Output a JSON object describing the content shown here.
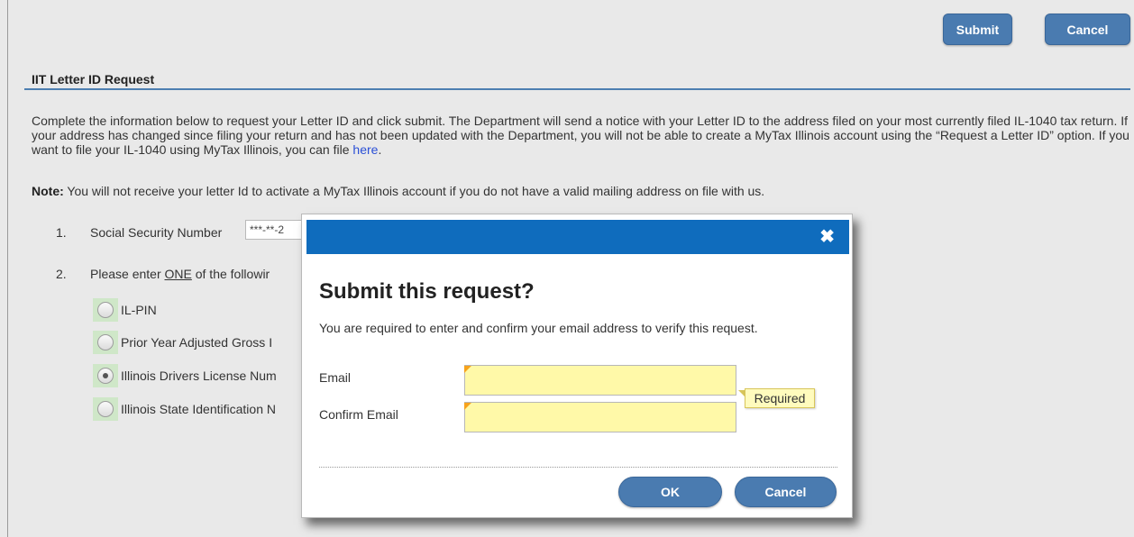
{
  "toolbar": {
    "submit_label": "Submit",
    "cancel_label": "Cancel"
  },
  "section": {
    "title": "IIT Letter ID Request"
  },
  "intro": {
    "text": "Complete the information below to request your Letter ID and click submit. The Department will send a notice with your Letter ID to the address filed on your most currently filed IL-1040 tax return. If your address has changed since filing your return and has not been updated with the Department, you will not be able to create a MyTax Illinois account using the “Request a Letter ID” option. If you want to file your IL-1040 using MyTax Illinois, you can file ",
    "link": "here",
    "end": "."
  },
  "note": {
    "label": "Note:",
    "text": " You will not receive your letter Id to activate a MyTax Illinois account if you do not have a valid mailing address on file with us."
  },
  "steps": [
    {
      "num": "1.",
      "text": "Social Security Number",
      "value": "***-**-2"
    },
    {
      "num": "2.",
      "text_before": "Please enter ",
      "text_underline": "ONE",
      "text_after": " of the followir"
    }
  ],
  "options": [
    {
      "label": "IL-PIN",
      "selected": false
    },
    {
      "label": "Prior Year Adjusted Gross I",
      "selected": false
    },
    {
      "label": "Illinois Drivers License Num",
      "selected": true
    },
    {
      "label": "Illinois State Identification N",
      "selected": false
    }
  ],
  "modal": {
    "close_glyph": "✖",
    "title": "Submit this request?",
    "description": "You are required to enter and confirm your email address to verify this request.",
    "email_label": "Email",
    "confirm_label": "Confirm Email",
    "email_value": "",
    "confirm_value": "",
    "required_tooltip": "Required",
    "ok_label": "OK",
    "cancel_label": "Cancel"
  },
  "colors": {
    "header_blue": "#0f6cbd",
    "button_blue": "#4a7bb0",
    "required_field": "#fff9a8",
    "radio_highlight": "#cfe7c8"
  }
}
